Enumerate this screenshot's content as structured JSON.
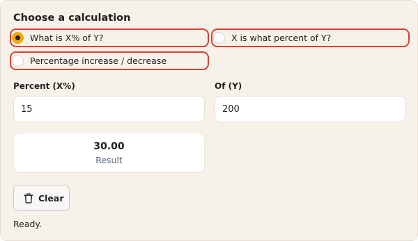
{
  "calculator": {
    "heading": "Choose a calculation",
    "options": [
      {
        "label": "What is X% of Y?",
        "selected": true
      },
      {
        "label": "X is what percent of Y?",
        "selected": false
      },
      {
        "label": "Percentage increase / decrease",
        "selected": false
      }
    ],
    "percent_field": {
      "label": "Percent (X%)",
      "value": "15"
    },
    "of_field": {
      "label": "Of (Y)",
      "value": "200"
    },
    "result": {
      "value": "30.00",
      "label": "Result"
    },
    "clear_button": {
      "label": "Clear",
      "icon": "trash-icon"
    },
    "status": "Ready.",
    "colors": {
      "panel_bg": "#f6f2ea",
      "highlight_border": "#d9412e",
      "radio_selected": "#f5a800",
      "result_label": "#56657a"
    }
  }
}
